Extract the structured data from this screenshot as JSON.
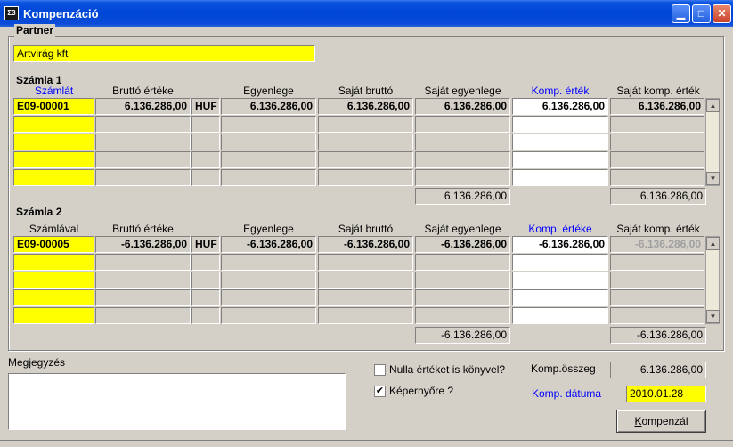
{
  "window": {
    "title": "Kompenzáció",
    "icon_text": "Σ3"
  },
  "partner": {
    "label": "Partner",
    "value": "Artvirág kft"
  },
  "szamla1": {
    "label": "Számla 1",
    "headers": [
      "Számlát",
      "Bruttó értéke",
      "Egyenlege",
      "Saját bruttó",
      "Saját egyenlege",
      "Komp. érték",
      "Saját komp. érték"
    ],
    "row": {
      "szamla": "E09-00001",
      "brutto": "6.136.286,00",
      "currency": "HUF",
      "egyenleg": "6.136.286,00",
      "sajat_brutto": "6.136.286,00",
      "sajat_egyenleg": "6.136.286,00",
      "komp": "6.136.286,00",
      "sajat_komp": "6.136.286,00"
    },
    "total_egyenleg": "6.136.286,00",
    "total_sajat_komp": "6.136.286,00"
  },
  "szamla2": {
    "label": "Számla 2",
    "headers": [
      "Számlával",
      "Bruttó értéke",
      "Egyenlege",
      "Saját bruttó",
      "Saját egyenlege",
      "Komp. értéke",
      "Saját komp. érték"
    ],
    "row": {
      "szamla": "E09-00005",
      "brutto": "-6.136.286,00",
      "currency": "HUF",
      "egyenleg": "-6.136.286,00",
      "sajat_brutto": "-6.136.286,00",
      "sajat_egyenleg": "-6.136.286,00",
      "komp": "-6.136.286,00",
      "sajat_komp": "-6.136.286,00"
    },
    "total_egyenleg": "-6.136.286,00",
    "total_sajat_komp": "-6.136.286,00"
  },
  "megjegyzes": {
    "label": "Megjegyzés",
    "value": ""
  },
  "options": {
    "nulla_label": "Nulla értéket is könyvel?",
    "nulla_checked": false,
    "kepernyo_label": "Képernyőre ?",
    "kepernyo_checked": true
  },
  "komp_osszeg": {
    "label": "Komp.összeg",
    "value": "6.136.286,00"
  },
  "komp_datum": {
    "label": "Komp. dátuma",
    "value": "2010.01.28"
  },
  "kompenzal_button": {
    "label_first": "K",
    "label_rest": "ompenzál"
  },
  "colors": {
    "titlebar": "#0046d6",
    "required": "#ffff00",
    "label_blue": "#0000ff",
    "window_bg": "#d4d0c8"
  }
}
